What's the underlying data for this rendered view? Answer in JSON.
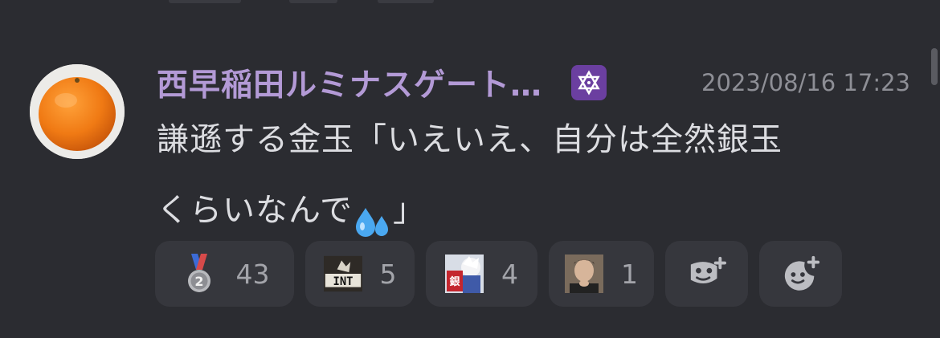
{
  "post": {
    "author": {
      "display_name": "西早稲田ルミナスゲート…",
      "badge_icon": "star-of-david-icon",
      "avatar_icon": "orange-avatar"
    },
    "timestamp": "2023/08/16 17:23",
    "message": {
      "line1": "謙遜する金玉「いえいえ、自分は全然銀玉",
      "line2_text": "くらいなんで",
      "line2_emoji": "sweat-droplets-emoji",
      "line2_end": "」"
    },
    "reactions": [
      {
        "emoji": "second-place-medal",
        "count": "43"
      },
      {
        "emoji": "int-custom-emoji",
        "count": "5"
      },
      {
        "emoji": "gintama-custom-emoji",
        "count": "4"
      },
      {
        "emoji": "man-photo-custom-emoji",
        "count": "1"
      }
    ],
    "add_reaction_buttons": [
      {
        "icon": "add-reaction-mask-icon"
      },
      {
        "icon": "add-reaction-smile-icon"
      }
    ]
  },
  "colors": {
    "background": "#2b2c31",
    "username": "#b39ad6",
    "badge": "#6b3fa0",
    "reaction_bg": "#36373d",
    "text": "#dcdde1",
    "muted": "#8e8f96"
  }
}
